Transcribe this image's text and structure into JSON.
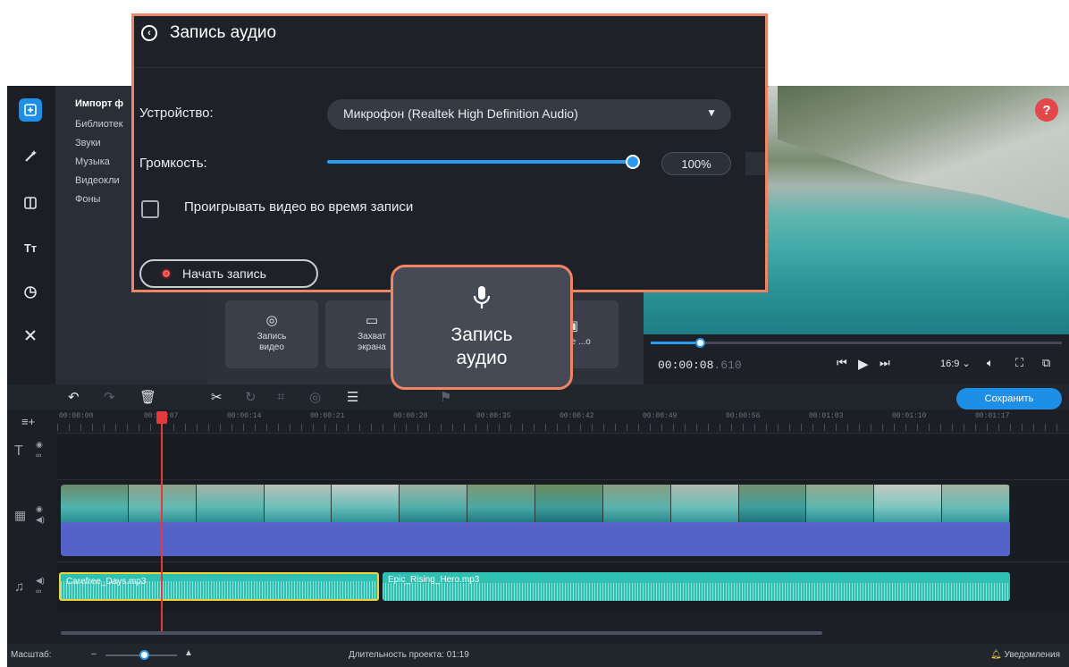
{
  "record_panel": {
    "title": "Запись аудио",
    "device_label": "Устройство:",
    "device_value": "Микрофон (Realtek High Definition Audio)",
    "volume_label": "Громкость:",
    "volume_value": "100%",
    "volume_level": 1.0,
    "play_video_label": "Проигрывать видео во время записи",
    "play_video_checked": false,
    "start_button": "Начать запись",
    "border_color": "#f08566"
  },
  "highlight_tile": {
    "icon": "microphone-icon",
    "label": "Запись аудио"
  },
  "sidebar": {
    "rail_icons": [
      "import-icon",
      "magic-wand-icon",
      "transitions-icon",
      "titles-icon",
      "stickers-icon",
      "tools-icon"
    ],
    "items": [
      {
        "label": "Импорт ф",
        "active": true
      },
      {
        "label": "Библиотек"
      },
      {
        "label": "Звуки"
      },
      {
        "label": "Музыка"
      },
      {
        "label": "Видеокли"
      },
      {
        "label": "Фоны"
      }
    ]
  },
  "import_tiles": [
    {
      "label": "Запись видео",
      "icon": "webcam-icon"
    },
    {
      "label": "Захват экрана",
      "icon": "monitor-icon"
    },
    {
      "label": "...рое ...о",
      "icon": "media-icon"
    }
  ],
  "player": {
    "timecode": "00:00:08",
    "timecode_ms": ".610",
    "progress": 0.12,
    "aspect": "16:9",
    "help": "?"
  },
  "timeline": {
    "save_button": "Сохранить",
    "ruler": [
      "00:00:00",
      "00:00:07",
      "00:00:14",
      "00:00:21",
      "00:00:28",
      "00:00:35",
      "00:00:42",
      "00:00:49",
      "00:00:56",
      "00:01:03",
      "00:01:10",
      "00:01:17"
    ],
    "music_clip_1": "Carefree_Days.mp3",
    "music_clip_2": "Epic_Rising_Hero.mp3"
  },
  "statusbar": {
    "zoom_label": "Масштаб:",
    "duration": "Длительность проекта: 01:19",
    "notifications": "Уведомления"
  },
  "colors": {
    "accent": "#1e8fe6",
    "highlight": "#f08566",
    "playhead": "#e33b3b",
    "audio_clip": "#2ec1b2",
    "video_audio": "#5563c9"
  }
}
